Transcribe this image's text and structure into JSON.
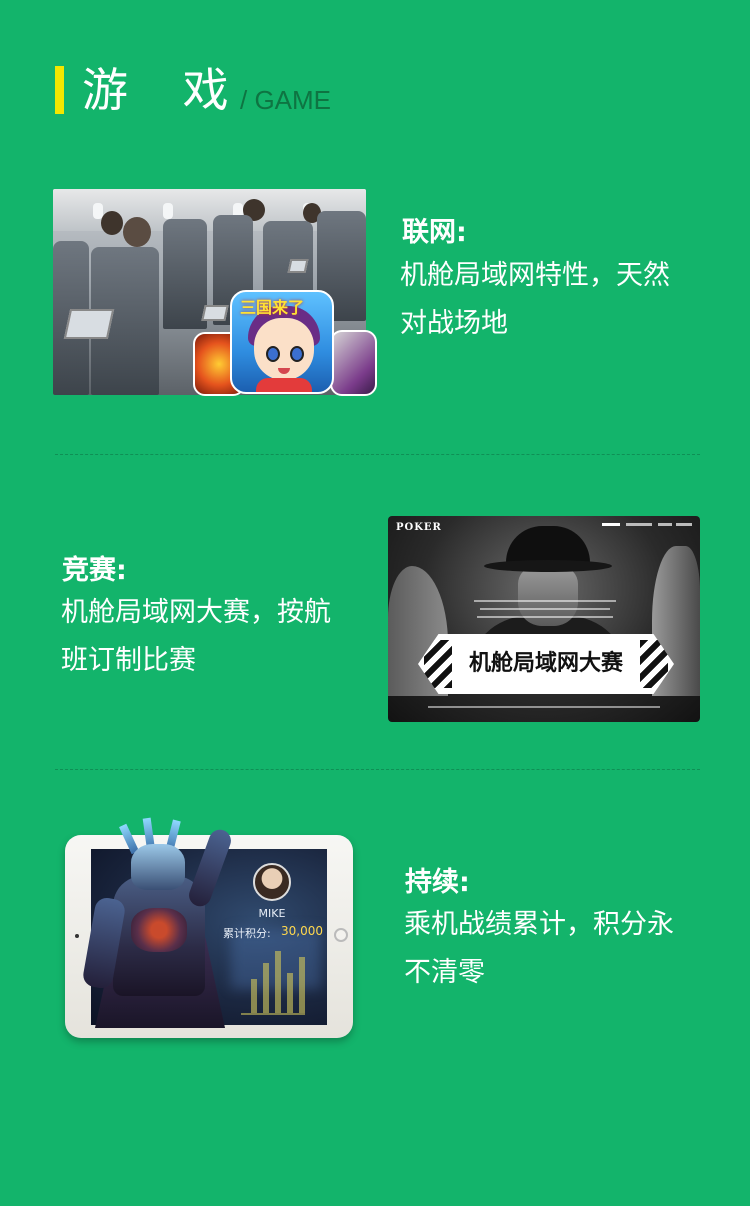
{
  "header": {
    "title_cn": "游 戏",
    "title_en": "/ GAME",
    "accent_color": "#f2e700",
    "background_color": "#13b46b"
  },
  "sections": [
    {
      "title": "联网:",
      "description": "机舱局域网特性，天然对战场地",
      "image": "airplane-cabin-with-game-icons",
      "app_icon_text": "三国来了"
    },
    {
      "title": "竞赛:",
      "description": "机舱局域网大赛，按航班订制比赛",
      "image": "poker-tournament-banner",
      "logo": "POKER",
      "banner_text": "机舱局域网大赛"
    },
    {
      "title": "持续:",
      "description": "乘机战绩累计，积分永不清零",
      "image": "tablet-game-score",
      "player_name": "MIKE",
      "score_label": "累计积分:",
      "score_value": "30,000",
      "score_bars": [
        0.55,
        0.8,
        1.0,
        0.65,
        0.9
      ]
    }
  ]
}
